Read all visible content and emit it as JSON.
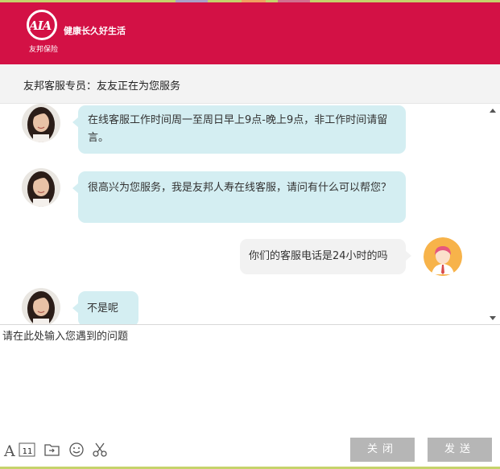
{
  "header": {
    "logo_mark": "AIA",
    "logo_cn": "友邦保险",
    "slogan": "健康长久好生活",
    "brand_color": "#d31145"
  },
  "subheader": {
    "title": "友邦客服专员：友友正在为您服务"
  },
  "messages": [
    {
      "role": "agent",
      "avatar": "agent-avatar",
      "text": "在线客服工作时间周一至周日早上9点-晚上9点，非工作时间请留言。"
    },
    {
      "role": "agent",
      "avatar": "agent-avatar",
      "text": "很高兴为您服务，我是友邦人寿在线客服，请问有什么可以帮您？"
    },
    {
      "role": "user",
      "avatar": "user-avatar",
      "text": "你们的客服电话是24小时的吗"
    },
    {
      "role": "agent",
      "avatar": "agent-avatar",
      "text": "不是呢"
    }
  ],
  "input": {
    "placeholder": "请在此处输入您遇到的问题",
    "value": ""
  },
  "toolbar": {
    "font_size": "11",
    "icons": [
      "font-icon",
      "font-size-icon",
      "folder-icon",
      "emoji-icon",
      "scissors-icon"
    ],
    "close_label": "关闭",
    "send_label": "发送"
  },
  "colors": {
    "agent_bubble": "#d4eef2",
    "user_bubble": "#f2f2f2",
    "button": "#b6b6b6",
    "accent_strip": "#c5d36b"
  }
}
